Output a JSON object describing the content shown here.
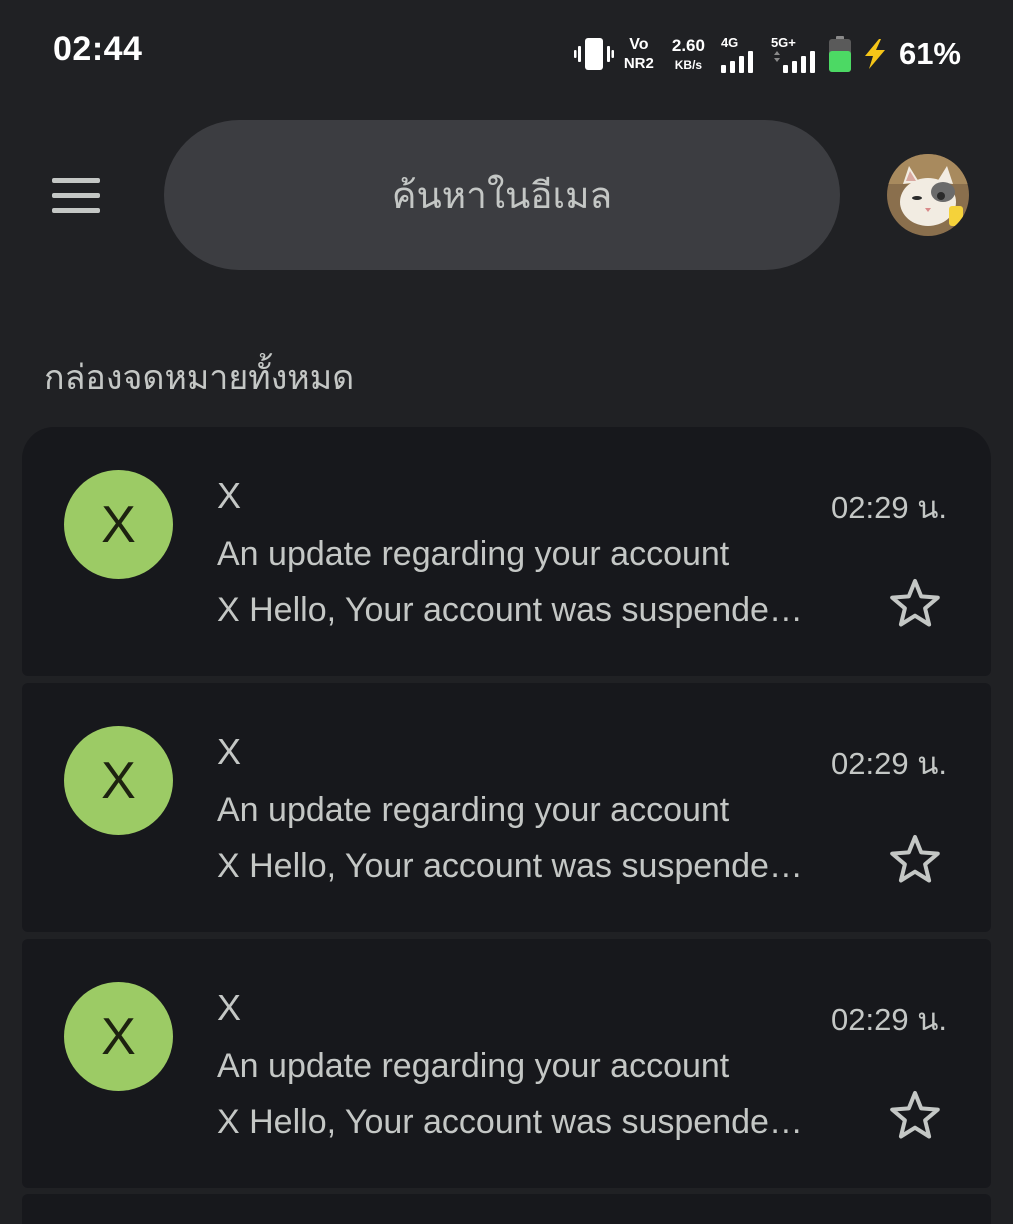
{
  "status_bar": {
    "time": "02:44",
    "volte_top": "Vo",
    "volte_bottom": "NR2",
    "speed_value": "2.60",
    "speed_unit": "KB/s",
    "network_1": "4G",
    "network_2": "5G+",
    "battery": "61%",
    "icons": [
      "vibrate-icon",
      "signal-icon",
      "battery-icon",
      "charging-bolt-icon"
    ]
  },
  "app_bar": {
    "menu_icon": "hamburger-menu-icon",
    "search_placeholder": "ค้นหาในอีเมล",
    "avatar_icon": "account-avatar"
  },
  "section": {
    "label": "กล่องจดหมายทั้งหมด"
  },
  "emails": [
    {
      "avatar_letter": "X",
      "sender": "X",
      "time": "02:29 น.",
      "subject": "An update regarding your account",
      "snippet": "X Hello, Your account was suspende…",
      "starred": false
    },
    {
      "avatar_letter": "X",
      "sender": "X",
      "time": "02:29 น.",
      "subject": "An update regarding your account",
      "snippet": "X Hello, Your account was suspende…",
      "starred": false
    },
    {
      "avatar_letter": "X",
      "sender": "X",
      "time": "02:29 น.",
      "subject": "An update regarding your account",
      "snippet": "X Hello, Your account was suspende…",
      "starred": false
    }
  ],
  "colors": {
    "background": "#202124",
    "card": "#17181c",
    "search_bar": "#3c3d41",
    "sender_avatar": "#9ccb65",
    "battery_fill": "#4cd964",
    "bolt": "#f5c518"
  }
}
